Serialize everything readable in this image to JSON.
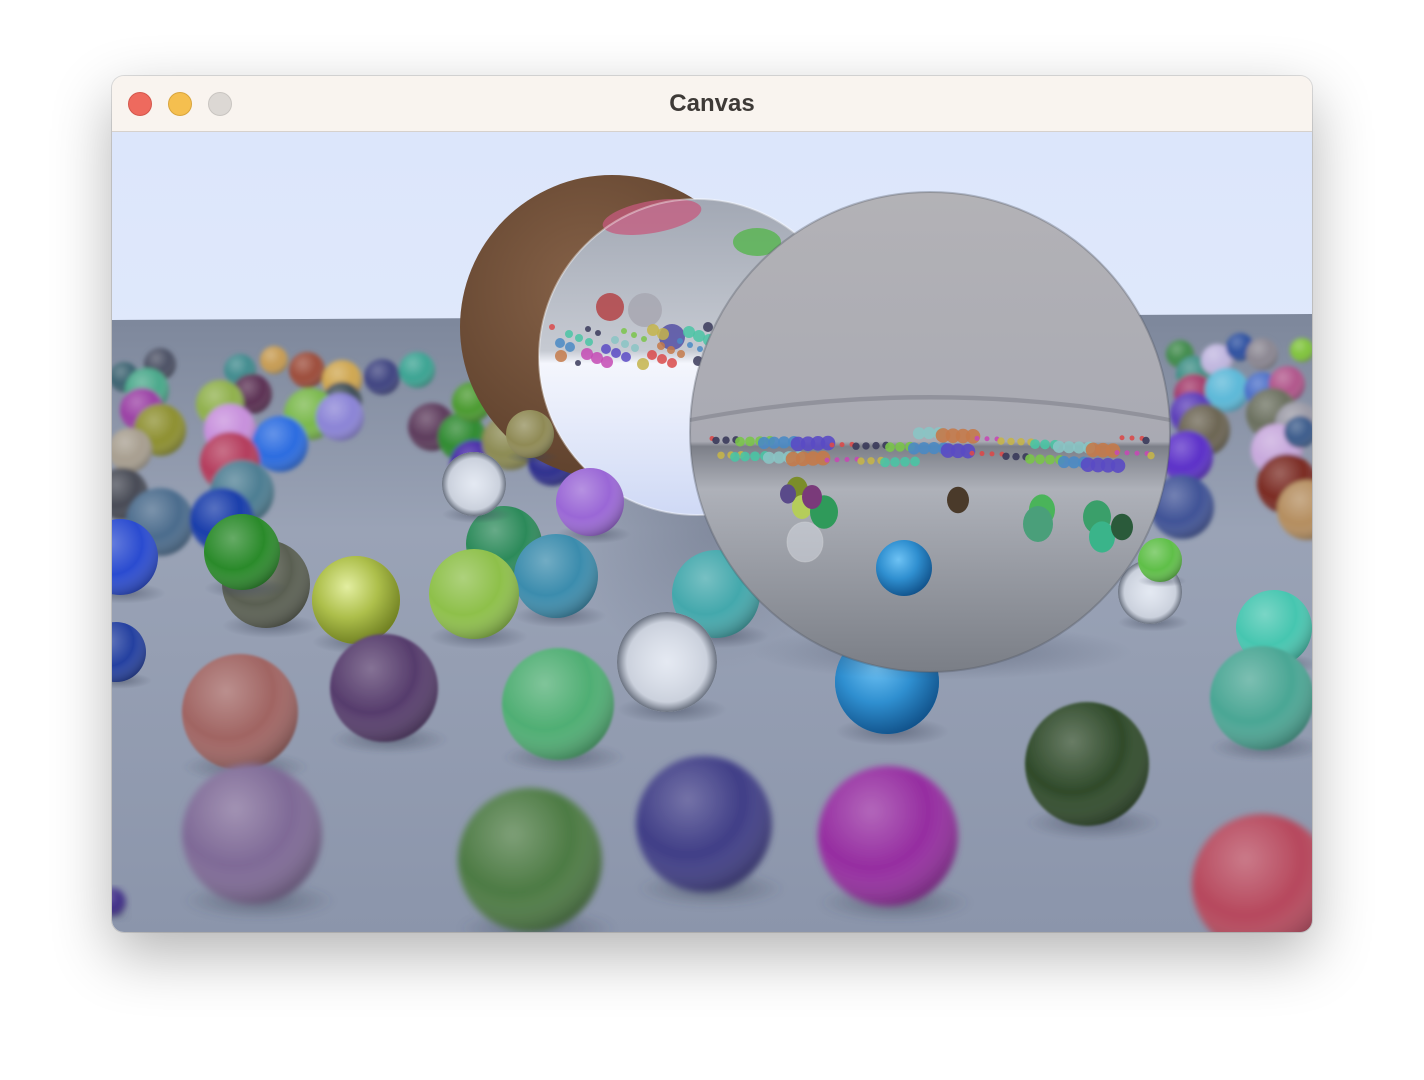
{
  "window": {
    "title": "Canvas",
    "controls": {
      "close_color": "#ee6a5e",
      "minimize_color": "#f5bf4f",
      "zoom_color": "#dcd8d4"
    }
  },
  "canvas": {
    "content": "ray-traced-spheres-render",
    "sky_color": "#dfe8fb",
    "ground_color": "#8c97ab"
  }
}
